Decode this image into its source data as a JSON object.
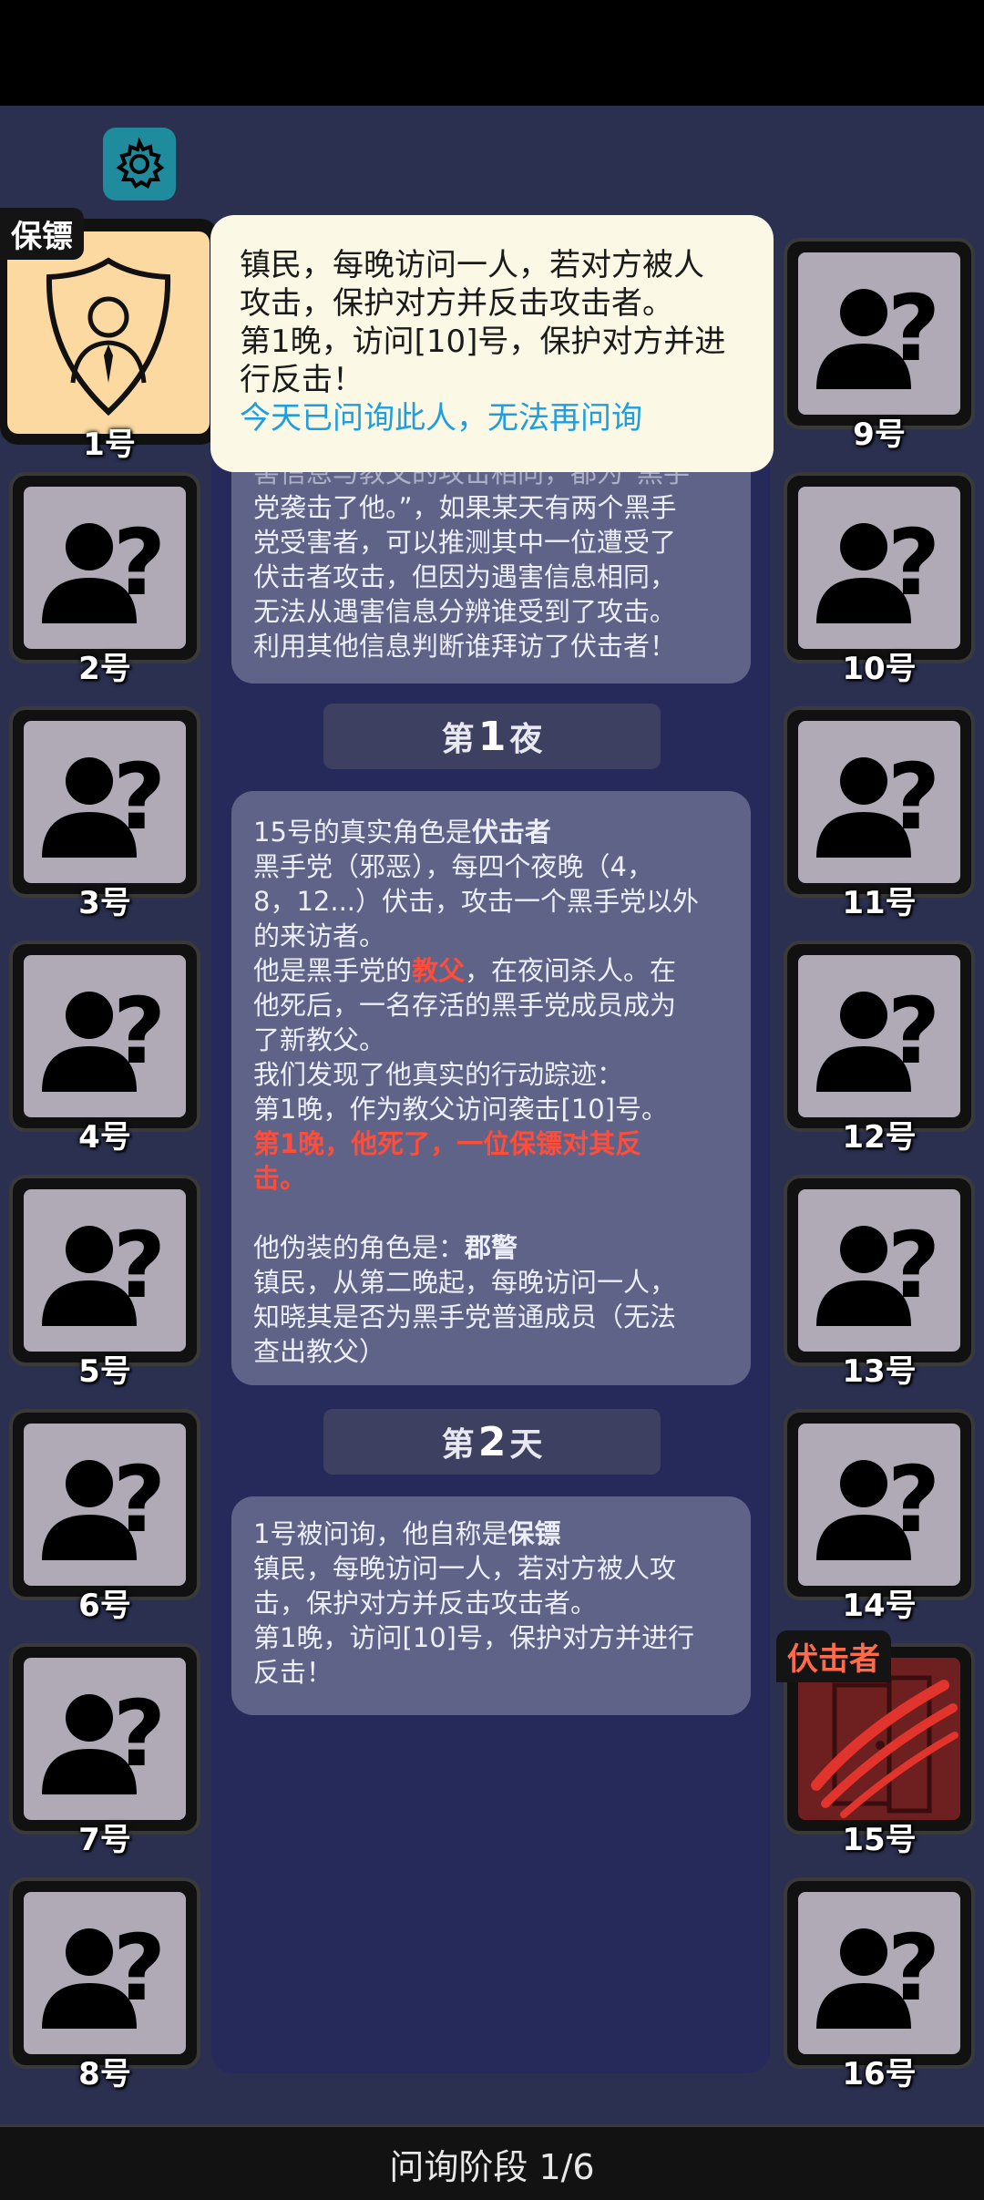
{
  "top_card": {
    "partial_line": "害信息与教父的攻击相同，都为“黑手",
    "lines": [
      "党袭击了他。”，如果某天有两个黑手",
      "党受害者，可以推测其中一位遭受了",
      "伏击者攻击，但因为遇害信息相同，",
      "无法从遇害信息分辨谁受到了攻击。",
      "利用其他信息判断谁拜访了伏击者！"
    ]
  },
  "night1_header": {
    "prefix": "第",
    "num": "1",
    "suffix": "夜"
  },
  "night1_card": {
    "intro_prefix": "15号的真实角色是",
    "intro_role": "伏击者",
    "line1": "黑手党（邪恶），每四个夜晚（4，",
    "line2": "8，12...）伏击，攻击一个黑手党以外",
    "line3": "的来访者。",
    "line4_prefix": "他是黑手党的",
    "line4_role": "教父",
    "line4_suffix": "，在夜间杀人。在",
    "line5": "他死后，一名存活的黑手党成员成为",
    "line6": "了新教父。",
    "line7": "我们发现了他真实的行动踪迹：",
    "line8": "第1晚，作为教父访问袭击[10]号。",
    "line9": "第1晚，他死了，一位保镖对其反",
    "line10": "击。",
    "disguise_prefix": "他伪装的角色是：",
    "disguise_role": "郡警",
    "line11": "镇民，从第二晚起，每晚访问一人，",
    "line12": "知晓其是否为黑手党普通成员（无法",
    "line13": "查出教父）"
  },
  "day2_header": {
    "prefix": "第",
    "num": "2",
    "suffix": "天"
  },
  "day2_card": {
    "intro_prefix": "1号被问询，他自称是",
    "intro_role": "保镖",
    "line1": "镇民，每晚访问一人，若对方被人攻",
    "line2": "击，保护对方并反击攻击者。",
    "line3": "第1晚，访问[10]号，保护对方并进行",
    "line4": "反击！"
  },
  "tooltip": {
    "line1": "镇民，每晚访问一人，若对方被人",
    "line2": "攻击，保护对方并反击攻击者。",
    "line3": "第1晚，访问[10]号，保护对方并进",
    "line4": "行反击！",
    "hint": "今天已问询此人，无法再问询"
  },
  "players_left": [
    {
      "label": "1号",
      "role": "保镖"
    },
    {
      "label": "2号"
    },
    {
      "label": "3号"
    },
    {
      "label": "4号"
    },
    {
      "label": "5号"
    },
    {
      "label": "6号"
    },
    {
      "label": "7号"
    },
    {
      "label": "8号"
    }
  ],
  "players_right": [
    {
      "label": "9号"
    },
    {
      "label": "10号"
    },
    {
      "label": "11号"
    },
    {
      "label": "12号"
    },
    {
      "label": "13号"
    },
    {
      "label": "14号"
    },
    {
      "label": "15号",
      "role": "伏击者"
    },
    {
      "label": "16号"
    }
  ],
  "bottom_bar": {
    "text": "问询阶段 1/6"
  },
  "colors": {
    "accent_red": "#ff4d3a",
    "hint_blue": "#1e9ee0",
    "settings_teal": "#1e8c9c",
    "bodyguard_bg": "#fbd9a0"
  },
  "icons": {
    "settings": "gear-icon",
    "unknown_player": "unknown-person-icon",
    "bodyguard": "shield-person-icon",
    "ambusher": "claw-door-icon"
  }
}
